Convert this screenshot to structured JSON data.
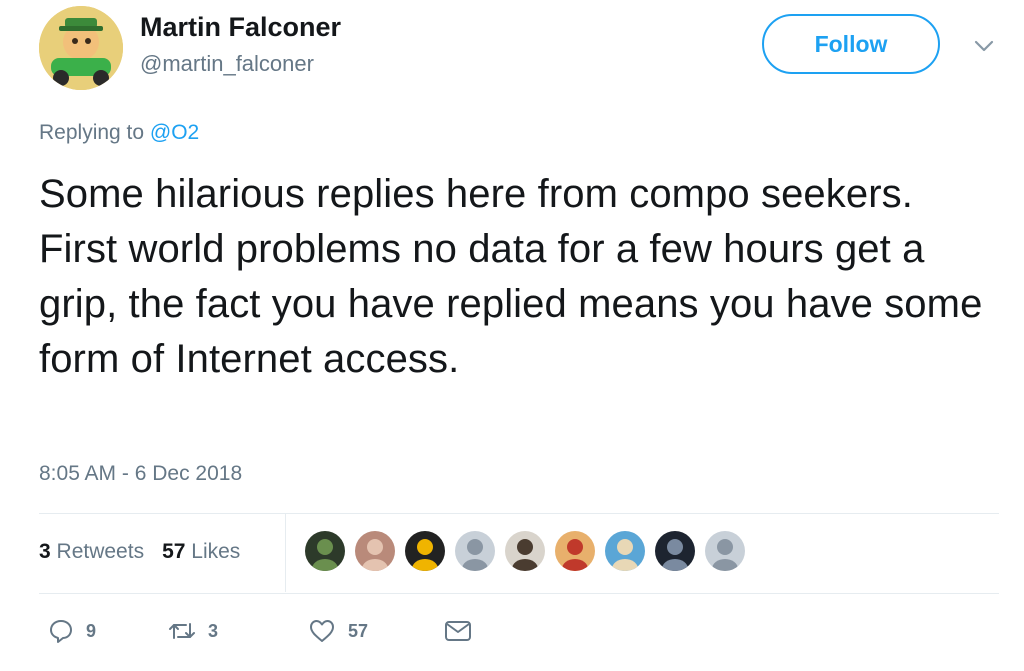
{
  "author": {
    "display_name": "Martin Falconer",
    "handle": "@martin_falconer",
    "avatar": "cartoon-driver-avatar"
  },
  "follow_button": {
    "label": "Follow"
  },
  "menu": {
    "icon": "chevron-down-icon"
  },
  "reply_context": {
    "prefix": "Replying to",
    "mention": "@O2"
  },
  "tweet": {
    "text": "Some hilarious replies here from compo seekers. First world problems no data for a few hours get a grip, the fact you have replied means you have some form of Internet access.",
    "timestamp": "8:05 AM - 6 Dec 2018"
  },
  "stats": {
    "retweets_count": "3",
    "retweets_label": "Retweets",
    "likes_count": "57",
    "likes_label": "Likes"
  },
  "liker_avatars": [
    {
      "name": "liker-avatar-1",
      "colors": [
        "#2d3a2a",
        "#6a8f4e"
      ]
    },
    {
      "name": "liker-avatar-2",
      "colors": [
        "#b98a7a",
        "#e4c3b0"
      ]
    },
    {
      "name": "liker-avatar-3",
      "colors": [
        "#222222",
        "#f0b400"
      ]
    },
    {
      "name": "liker-avatar-4",
      "colors": [
        "#c8d0d8",
        "#8a96a3"
      ]
    },
    {
      "name": "liker-avatar-5",
      "colors": [
        "#d9d4cc",
        "#4a3c30"
      ]
    },
    {
      "name": "liker-avatar-6",
      "colors": [
        "#e8b06c",
        "#c0392b"
      ]
    },
    {
      "name": "liker-avatar-7",
      "colors": [
        "#5aa6d6",
        "#e8d8b6"
      ]
    },
    {
      "name": "liker-avatar-8",
      "colors": [
        "#1d2430",
        "#7a8aa0"
      ]
    },
    {
      "name": "liker-avatar-9",
      "colors": [
        "#c8d0d8",
        "#8a96a3"
      ]
    }
  ],
  "actions": {
    "reply": {
      "icon": "reply-icon",
      "count": "9"
    },
    "retweet": {
      "icon": "retweet-icon",
      "count": "3"
    },
    "like": {
      "icon": "heart-icon",
      "count": "57"
    },
    "dm": {
      "icon": "envelope-icon"
    }
  },
  "colors": {
    "accent": "#1da1f2",
    "secondary_text": "#657786",
    "primary_text": "#14171a",
    "divider": "#e6ecf0"
  }
}
